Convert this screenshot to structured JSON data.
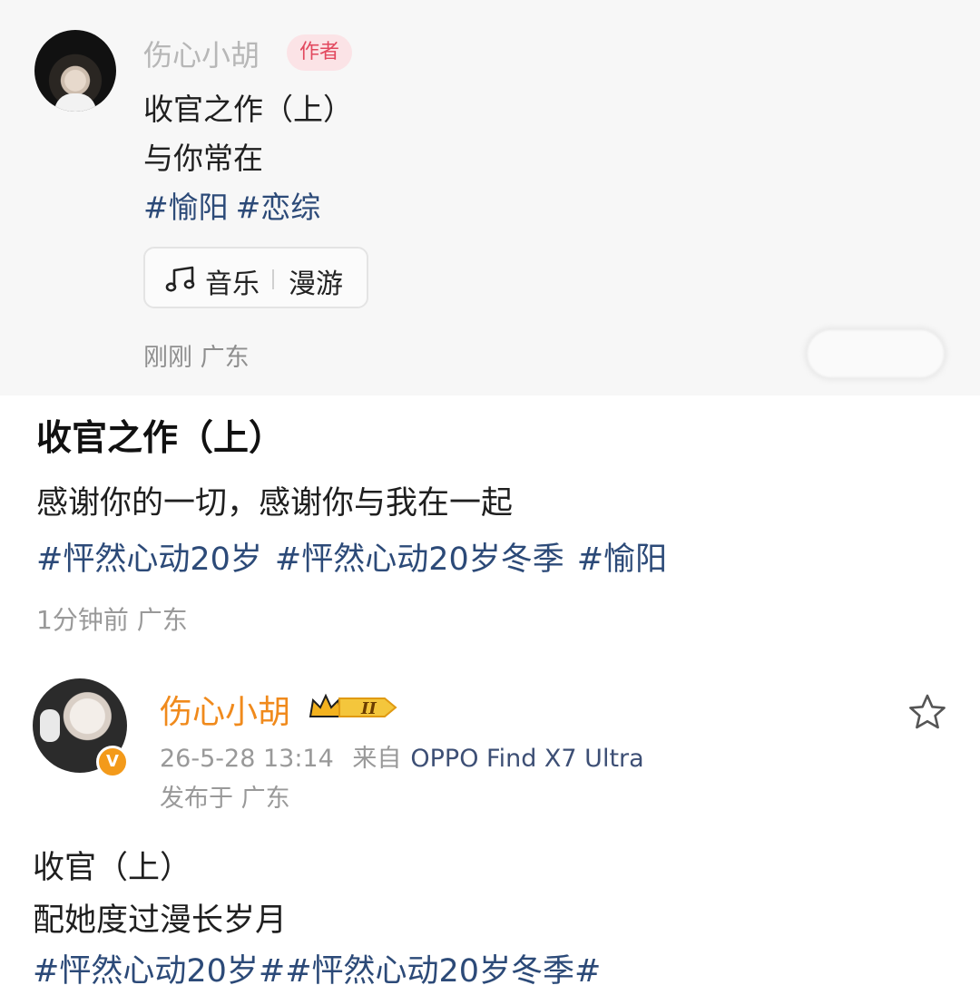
{
  "comment": {
    "username": "伤心小胡",
    "author_badge": "作者",
    "lines": [
      "收官之作（上）",
      "与你常在"
    ],
    "tags": [
      "#愉阳",
      "#恋综"
    ],
    "music": {
      "label": "音乐",
      "title": "漫游"
    },
    "meta": "刚刚  广东"
  },
  "post": {
    "title": "收官之作（上）",
    "body": "感谢你的一切，感谢你与我在一起",
    "tags": [
      "#怦然心动20岁",
      "#怦然心动20岁冬季",
      "#愉阳"
    ],
    "meta": "1分钟前  广东"
  },
  "weibo": {
    "username": "伤心小胡",
    "level_badge": "II",
    "verified_mark": "V",
    "timestamp": "26-5-28 13:14",
    "source_prefix": "来自",
    "device": "OPPO Find X7 Ultra",
    "location": "发布于 广东",
    "lines": [
      "收官（上）",
      "配她度过漫长岁月"
    ],
    "tags": "#怦然心动20岁##怦然心动20岁冬季#"
  },
  "colors": {
    "author_badge_bg": "#fbe3e6",
    "author_badge_text": "#e2485e",
    "hashtag": "#2c4a78",
    "vip_name": "#f08a1c",
    "verified": "#f39a1a"
  },
  "icons": [
    "music-note-icon",
    "crown-level-icon",
    "verified-v-icon",
    "star-icon"
  ]
}
